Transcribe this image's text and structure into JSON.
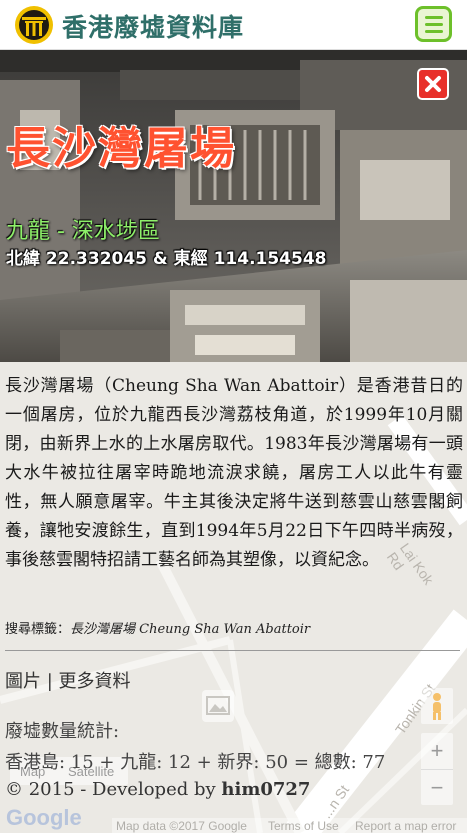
{
  "header": {
    "site_title": "香港廢墟資料庫"
  },
  "hero": {
    "title": "長沙灣屠場",
    "district": "九龍 - 深水埗區",
    "coords": "北緯 22.332045 & 東經 114.154548"
  },
  "content": {
    "description": "長沙灣屠場（Cheung Sha Wan Abattoir）是香港昔日的一個屠房，位於九龍西長沙灣荔枝角道，於1999年10月關閉，由新界上水的上水屠房取代。1983年長沙灣屠場有一頭大水牛被拉往屠宰時跪地流淚求饒，屠房工人以此牛有靈性，無人願意屠宰。牛主其後決定將牛送到慈雲山慈雲閣飼養，讓牠安渡餘生，直到1994年5月22日下午四時半病歿，事後慈雲閣特招請工藝名師為其塑像，以資紀念。",
    "tags_label": "搜尋標籤：",
    "tags_value": "長沙灣屠場 Cheung Sha Wan Abattoir",
    "nav_pictures": "圖片",
    "nav_separator": " | ",
    "nav_more": "更多資料",
    "stats_label": "廢墟數量統計:",
    "stats_line": "香港島: 15 + 九龍: 12 + 新界: 50 = 總數: 77",
    "footer_prefix": "© 2015 - Developed by ",
    "footer_author": "him0727"
  },
  "map": {
    "labels": {
      "map_tab": "Map",
      "satellite_tab": "Satellite",
      "google": "Google",
      "attribution": "Map data ©2017 Google",
      "terms": "Terms of Use",
      "report": "Report a map error",
      "street_1": "Tonkin St",
      "street_2": "Lai Kok Rd",
      "street_3": "...n St"
    },
    "zoom_in": "+",
    "zoom_out": "−"
  },
  "icons": {
    "logo": "temple-gate-icon",
    "menu": "hamburger-menu-icon",
    "close": "close-x-icon",
    "pegman": "pegman-icon",
    "marker": "photo-marker-icon"
  },
  "colors": {
    "title_green": "#2f6f69",
    "menu_green": "#6dc02a",
    "hero_title": "#ff5230",
    "district_green": "#8ef06a",
    "close_red": "#e8302a"
  }
}
